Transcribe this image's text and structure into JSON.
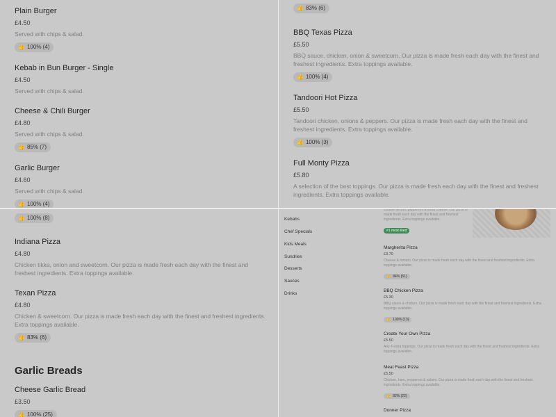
{
  "tl": {
    "items": [
      {
        "name": "Plain Burger",
        "price": "£4.50",
        "desc": "Served with chips & salad.",
        "rating": "100% (4)"
      },
      {
        "name": "Kebab in Bun Burger - Single",
        "price": "£4.50",
        "desc": "Served with chips & salad."
      },
      {
        "name": "Cheese & Chili Burger",
        "price": "£4.80",
        "desc": "Served with chips & salad.",
        "rating": "85% (7)"
      },
      {
        "name": "Garlic Burger",
        "price": "£4.60",
        "desc": "Served with chips & salad.",
        "rating": "100% (4)"
      }
    ]
  },
  "tr": {
    "top_rating": "83% (6)",
    "items": [
      {
        "name": "BBQ Texas Pizza",
        "price": "£5.50",
        "desc": "BBQ sauce, chicken, onion & sweetcorn. Our pizza is made fresh each day with the finest and freshest ingredients. Extra toppings available.",
        "rating": "100% (4)"
      },
      {
        "name": "Tandoori Hot Pizza",
        "price": "£5.50",
        "desc": "Tandoori chicken, onions & peppers. Our pizza is made fresh each day with the finest and freshest ingredients. Extra toppings available.",
        "rating": "100% (3)"
      },
      {
        "name": "Full Monty Pizza",
        "price": "£5.80",
        "desc": "A selection of the best toppings. Our pizza is made fresh each day with the finest and freshest ingredients. Extra toppings available."
      }
    ]
  },
  "bl": {
    "top_rating": "100% (8)",
    "items": [
      {
        "name": "Indiana Pizza",
        "price": "£4.80",
        "desc": "Chicken tikka, onion and sweetcorn. Our pizza is made fresh each day with the finest and freshest ingredients. Extra toppings available."
      },
      {
        "name": "Texan Pizza",
        "price": "£4.80",
        "desc": "Chicken & sweetcorn. Our pizza is made fresh each day with the finest and freshest ingredients. Extra toppings available.",
        "rating": "83% (6)"
      }
    ],
    "section_title": "Garlic Breads",
    "garlic": {
      "name": "Cheese Garlic Bread",
      "price": "£3.50",
      "rating": "100% (25)"
    }
  },
  "br": {
    "nav": [
      "Kebabs",
      "Chef Specials",
      "Kids Meals",
      "Sundries",
      "Desserts",
      "Sauces",
      "Drinks"
    ],
    "top_desc": "Double decker, pepperoni & extra cheese. Our pizza is made fresh each day with the finest and freshest ingredients. Extra toppings available.",
    "top_badge": "#1 most liked",
    "items": [
      {
        "name": "Margherita Pizza",
        "price": "£3.70",
        "desc": "Cheese & tomato. Our pizza is made fresh each day with the finest and freshest ingredients. Extra toppings available.",
        "rating": "84% (51)"
      },
      {
        "name": "BBQ Chicken Pizza",
        "price": "£5.30",
        "desc": "BBQ sauce & chicken. Our pizza is made fresh each day with the finest and freshest ingredients. Extra toppings available.",
        "rating": "100% (13)"
      },
      {
        "name": "Create Your Own Pizza",
        "price": "£5.50",
        "desc": "Any 4 extra toppings. Our pizza is made fresh each day with the finest and freshest ingredients. Extra toppings available."
      },
      {
        "name": "Meat Feast Pizza",
        "price": "£5.50",
        "desc": "Chicken, ham, pepperoni & salami. Our pizza is made fresh each day with the finest and freshest ingredients. Extra toppings available.",
        "rating": "82% (22)"
      },
      {
        "name": "Donner Pizza",
        "price": ""
      }
    ]
  },
  "colors": {
    "background": "#c9c9c9",
    "divider": "#ececec",
    "badge_green": "#3f8b55",
    "rating_pill": "#b9b9b9"
  },
  "icons": {
    "rating": "thumbs-up-icon"
  }
}
